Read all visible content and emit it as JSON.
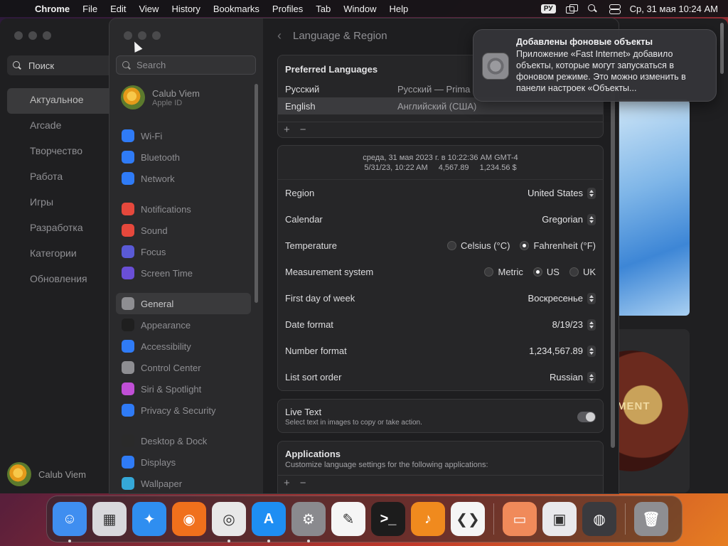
{
  "menubar": {
    "app_name": "Chrome",
    "menus": [
      "File",
      "Edit",
      "View",
      "History",
      "Bookmarks",
      "Profiles",
      "Tab",
      "Window",
      "Help"
    ],
    "input_source": "РУ",
    "datetime": "Ср, 31 мая  10:24 AM"
  },
  "appstore": {
    "search_placeholder": "Поиск",
    "nav": [
      "Актуальное",
      "Arcade",
      "Творчество",
      "Работа",
      "Игры",
      "Разработка",
      "Категории",
      "Обновления"
    ],
    "active_index": 0,
    "user_name": "Calub Viem",
    "art_text": "MENT"
  },
  "settings": {
    "search_placeholder": "Search",
    "account": {
      "name": "Calub Viem",
      "sub": "Apple ID"
    },
    "sidebar": [
      {
        "label": "Wi-Fi",
        "icon": "wifi-icon",
        "color": "#2f7bf6"
      },
      {
        "label": "Bluetooth",
        "icon": "bluetooth-icon",
        "color": "#2f7bf6"
      },
      {
        "label": "Network",
        "icon": "globe-icon",
        "color": "#2f7bf6",
        "group_end": true
      },
      {
        "label": "Notifications",
        "icon": "bell-icon",
        "color": "#e5483c"
      },
      {
        "label": "Sound",
        "icon": "speaker-icon",
        "color": "#e5483c"
      },
      {
        "label": "Focus",
        "icon": "moon-icon",
        "color": "#5a5ad6"
      },
      {
        "label": "Screen Time",
        "icon": "hourglass-icon",
        "color": "#6a4fd6",
        "group_end": true
      },
      {
        "label": "General",
        "icon": "gear-icon",
        "color": "#8e8e92",
        "active": true
      },
      {
        "label": "Appearance",
        "icon": "appearance-icon",
        "color": "#1f1f1f"
      },
      {
        "label": "Accessibility",
        "icon": "accessibility-icon",
        "color": "#2f7bf6"
      },
      {
        "label": "Control Center",
        "icon": "toggles-icon",
        "color": "#8e8e92"
      },
      {
        "label": "Siri & Spotlight",
        "icon": "siri-icon",
        "color": "#c04fd6"
      },
      {
        "label": "Privacy & Security",
        "icon": "hand-icon",
        "color": "#2f7bf6",
        "group_end": true
      },
      {
        "label": "Desktop & Dock",
        "icon": "dock-icon",
        "color": "#2a2a2a"
      },
      {
        "label": "Displays",
        "icon": "display-icon",
        "color": "#2f7bf6"
      },
      {
        "label": "Wallpaper",
        "icon": "wallpaper-icon",
        "color": "#35a8d8"
      }
    ],
    "header": {
      "title": "Language & Region"
    },
    "preferred": {
      "title": "Preferred Languages",
      "rows": [
        {
          "name": "Русский",
          "detail": "Русский — Prima"
        },
        {
          "name": "English",
          "detail": "Английский (США)",
          "selected": true
        }
      ],
      "plus": "+",
      "minus": "−"
    },
    "preview": {
      "line1": "среда, 31 мая 2023 г. в 10:22:36 AM GMT-4",
      "date": "5/31/23, 10:22 AM",
      "number": "4,567.89",
      "currency": "1,234.56 $"
    },
    "fields": {
      "region": {
        "label": "Region",
        "value": "United States"
      },
      "calendar": {
        "label": "Calendar",
        "value": "Gregorian"
      },
      "temperature": {
        "label": "Temperature",
        "options": [
          "Celsius (°C)",
          "Fahrenheit (°F)"
        ],
        "selected": 1
      },
      "measurement": {
        "label": "Measurement system",
        "options": [
          "Metric",
          "US",
          "UK"
        ],
        "selected": 1
      },
      "first_day": {
        "label": "First day of week",
        "value": "Воскресенье"
      },
      "date_format": {
        "label": "Date format",
        "value": "8/19/23"
      },
      "number_format": {
        "label": "Number format",
        "value": "1,234,567.89"
      },
      "sort_order": {
        "label": "List sort order",
        "value": "Russian"
      }
    },
    "live_text": {
      "title": "Live Text",
      "desc": "Select text in images to copy or take action.",
      "on": true
    },
    "applications": {
      "title": "Applications",
      "desc": "Customize language settings for the following applications:"
    }
  },
  "notification": {
    "title": "Добавлены фоновые объекты",
    "body": "Приложение «Fast Internet» добавило объекты, которые могут запускаться в фоновом режиме. Это можно изменить в панели настроек «Объекты..."
  },
  "dock": {
    "apps": [
      {
        "name": "finder",
        "icon": "finder-icon",
        "color": "#3f8ef0",
        "glyph": "☺",
        "running": true
      },
      {
        "name": "launchpad",
        "icon": "launchpad-icon",
        "color": "#d9d9dc",
        "glyph": "▦",
        "running": false
      },
      {
        "name": "safari",
        "icon": "safari-icon",
        "color": "#2f8ef0",
        "glyph": "✦",
        "running": false
      },
      {
        "name": "firefox",
        "icon": "firefox-icon",
        "color": "#f0701c",
        "glyph": "◉",
        "running": false
      },
      {
        "name": "chrome",
        "icon": "chrome-icon",
        "color": "#e8e8e8",
        "glyph": "◎",
        "running": true
      },
      {
        "name": "app-store",
        "icon": "app-store-icon",
        "color": "#1e8ef3",
        "glyph": "A",
        "running": true
      },
      {
        "name": "system-settings",
        "icon": "system-settings-icon",
        "color": "#8a8a8e",
        "glyph": "⚙",
        "running": true
      },
      {
        "name": "textedit",
        "icon": "textedit-icon",
        "color": "#f5f5f5",
        "glyph": "✎",
        "running": false
      },
      {
        "name": "terminal",
        "icon": "terminal-icon",
        "color": "#1c1c1c",
        "glyph": ">_",
        "running": false
      },
      {
        "name": "garageband",
        "icon": "garageband-icon",
        "color": "#f08a1e",
        "glyph": "♪",
        "running": false
      },
      {
        "name": "vscode",
        "icon": "vscode-icon",
        "color": "#f5f5f5",
        "glyph": "❮❯",
        "running": false
      },
      {
        "sep": true
      },
      {
        "name": "remote-desktop",
        "icon": "laptop-icon",
        "color": "#f08a5a",
        "glyph": "▭",
        "running": false
      },
      {
        "name": "parallels",
        "icon": "parallels-icon",
        "color": "#e9e9ec",
        "glyph": "▣",
        "running": false
      },
      {
        "name": "network-utility",
        "icon": "globe-icon",
        "color": "#3a3a3e",
        "glyph": "◍",
        "running": false
      },
      {
        "sep": true
      },
      {
        "name": "trash",
        "icon": "trash-icon",
        "color": "#8e8e92",
        "glyph": "🗑",
        "running": false
      }
    ]
  }
}
